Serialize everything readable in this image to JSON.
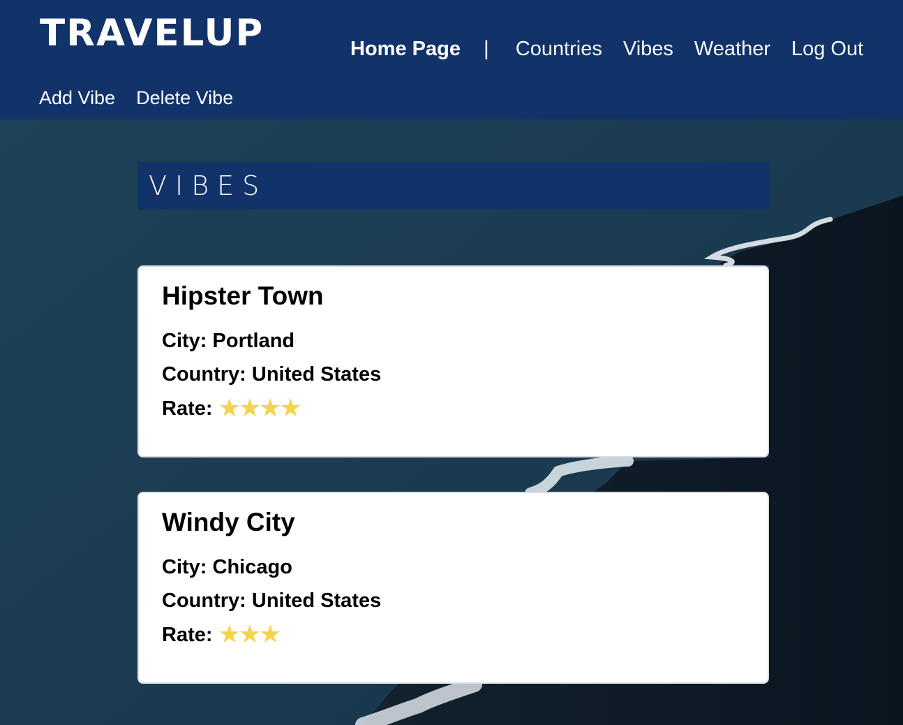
{
  "brand": "TRAVELUP",
  "nav": {
    "home": "Home Page",
    "separator": "|",
    "countries": "Countries",
    "vibes": "Vibes",
    "weather": "Weather",
    "logout": "Log Out"
  },
  "subnav": {
    "add": "Add Vibe",
    "delete": "Delete Vibe"
  },
  "page_title": "VIBES",
  "vibes": [
    {
      "name": "Hipster Town",
      "city_label": "City:",
      "city": "Portland",
      "country_label": "Country:",
      "country": "United States",
      "rate_label": "Rate:",
      "rating": 4,
      "stars": "★★★★"
    },
    {
      "name": "Windy City",
      "city_label": "City:",
      "city": "Chicago",
      "country_label": "Country:",
      "country": "United States",
      "rate_label": "Rate:",
      "rating": 3,
      "stars": "★★★"
    }
  ],
  "colors": {
    "header": "#12336a",
    "star": "#f6d44a",
    "card_bg": "#ffffff",
    "ocean": "#1d3f55",
    "sand": "#0e1a26",
    "surf": "#ffffff"
  }
}
